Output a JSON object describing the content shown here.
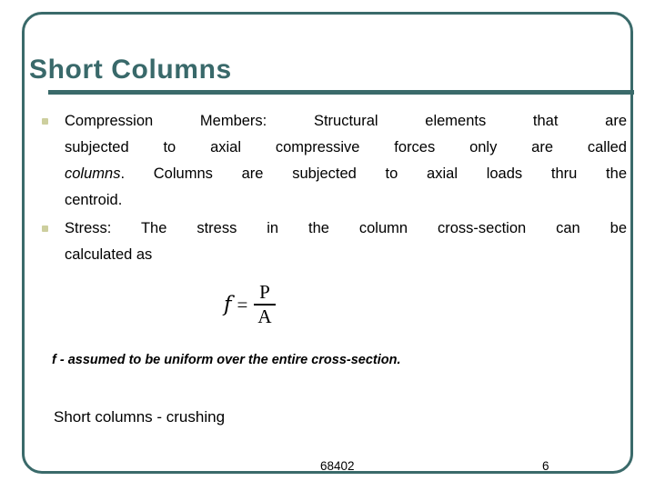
{
  "slide": {
    "title": "Short Columns",
    "accent_color": "#3a6a6a",
    "bullet_color": "#cdcf9e",
    "bullets": [
      {
        "lines": [
          "Compression Members:    Structural elements that are",
          "subjected to axial compressive forces only are called",
          "columns. Columns are subjected to axial loads thru the",
          "centroid."
        ],
        "italic_word": "columns"
      },
      {
        "lines": [
          "Stress: The stress in the column cross-section can be",
          "calculated as"
        ]
      }
    ],
    "formula": {
      "lhs": "f",
      "equals": "=",
      "numerator": "P",
      "denominator": "A"
    },
    "note": "f - assumed to be uniform over the entire cross-section.",
    "subnote": "Short columns - crushing",
    "footer": {
      "code": "68402",
      "page": "6"
    }
  }
}
